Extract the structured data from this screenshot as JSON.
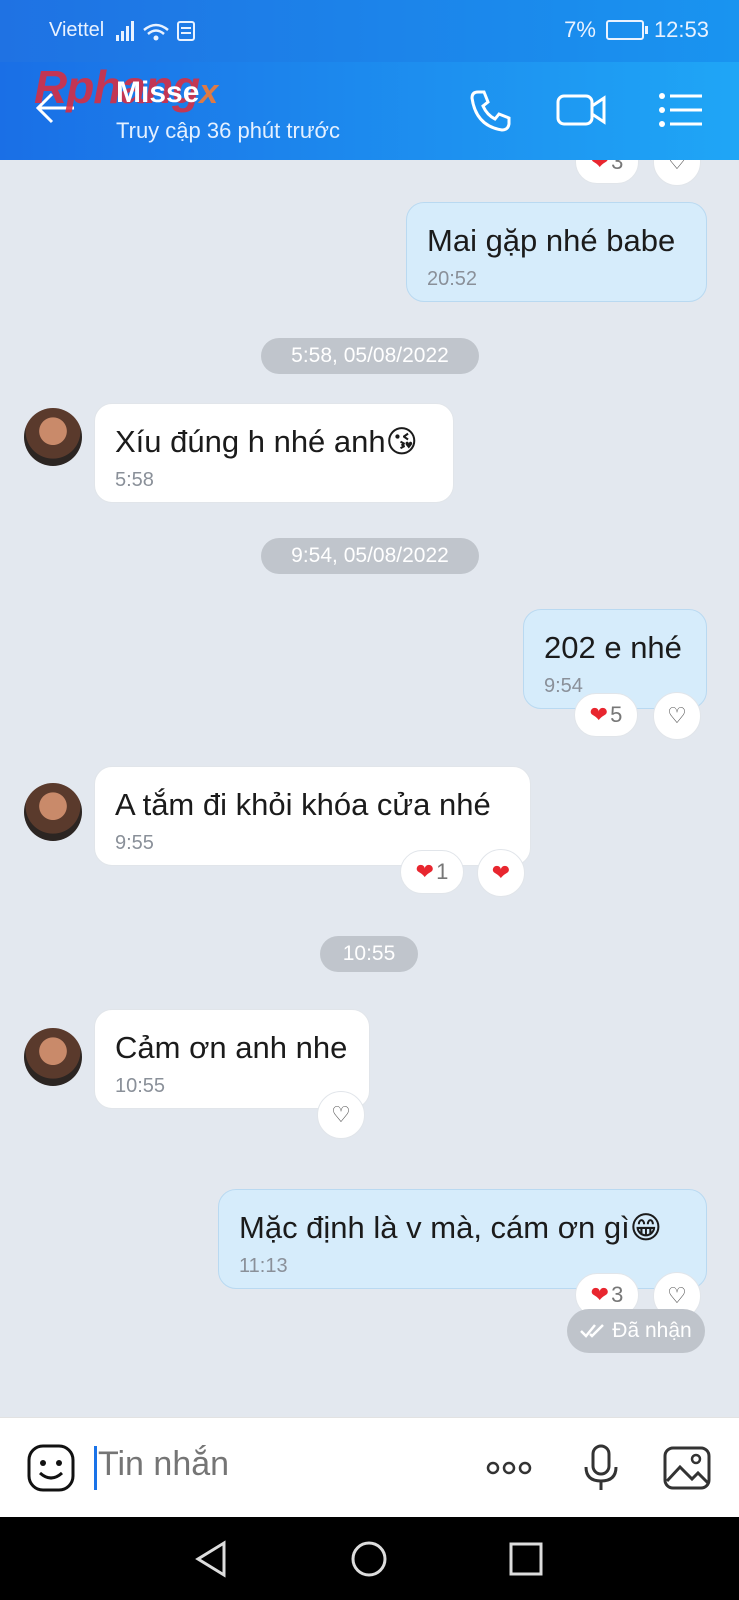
{
  "status_bar": {
    "carrier": "Viettel",
    "battery": "7%",
    "time": "12:53"
  },
  "header": {
    "title": "Misse",
    "subtitle": "Truy cập 36 phút trước",
    "watermark": "Rphang",
    "watermark_suffix": "x"
  },
  "messages": [
    {
      "text": "Mai gặp nhé babe",
      "time": "20:52"
    },
    {
      "text": "Xíu đúng h nhé anh😘",
      "time": "5:58"
    },
    {
      "text": "202 e nhé",
      "time": "9:54",
      "reaction_count": "5"
    },
    {
      "text": "A tắm đi khỏi khóa cửa nhé",
      "time": "9:55",
      "reaction_count": "1"
    },
    {
      "text": "Cảm ơn anh nhe",
      "time": "10:55"
    },
    {
      "text": "Mặc định là v mà, cám ơn gì😁",
      "time": "11:13",
      "reaction_count": "3"
    }
  ],
  "top_partial_reaction_count": "3",
  "date_separators": [
    "5:58, 05/08/2022",
    "9:54, 05/08/2022",
    "10:55"
  ],
  "received_status": "Đã nhận",
  "input": {
    "placeholder": "Tin nhắn"
  },
  "colors": {
    "header_start": "#1a6fe6",
    "header_end": "#1fa6f6",
    "outgoing_bubble": "#d6ecfb",
    "incoming_bubble": "#ffffff",
    "heart": "#e8262f"
  }
}
